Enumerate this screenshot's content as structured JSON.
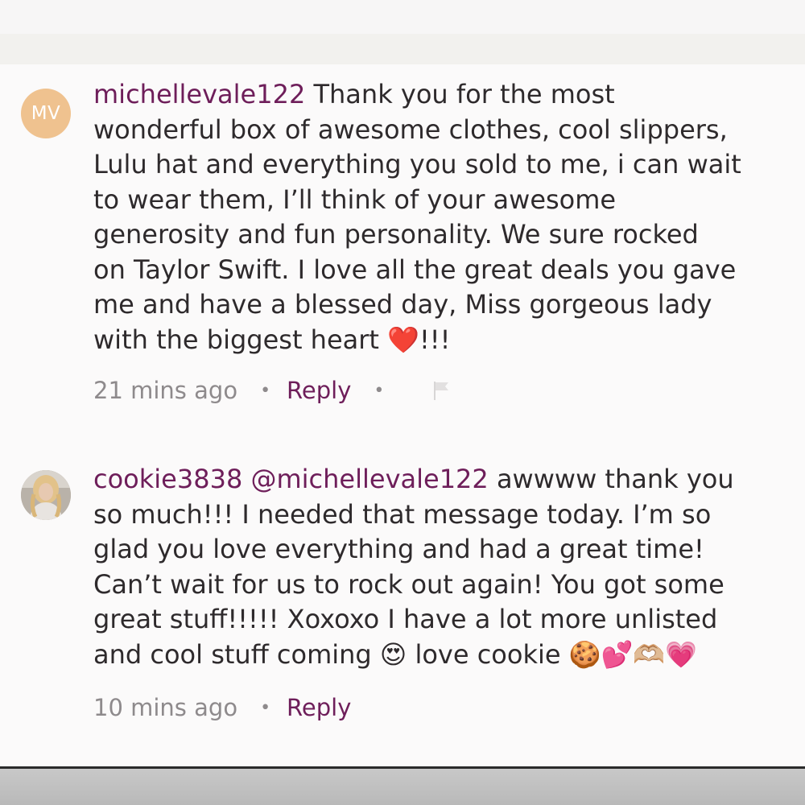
{
  "comments": [
    {
      "avatar_initials": "MV",
      "username": "michellevale122",
      "mention": "",
      "text": "Thank you for the most\nwonderful box of awesome clothes, cool slippers,\nLulu hat and everything you sold to me, i can wait\nto wear them, I’ll think of your awesome\ngenerosity and fun personality.  We sure rocked\non Taylor Swift.  I love all the great deals you gave\nme and have a blessed day, Miss gorgeous lady\nwith the biggest heart ❤️!!!",
      "time": "21 mins ago",
      "reply_label": "Reply",
      "has_flag": true
    },
    {
      "avatar_initials": "",
      "username": "cookie3838",
      "mention": "@michellevale122",
      "text": "awwww thank you\nso much!!! I needed that message today. I’m so\nglad you love everything and had a great time!\nCan’t wait for us to rock out again! You got some\ngreat stuff!!!!! Xoxoxo I have a lot more unlisted\nand cool stuff coming 😍 love cookie 🍪💕🫶🏼💗",
      "time": "10 mins ago",
      "reply_label": "Reply",
      "has_flag": false
    }
  ],
  "icons": {
    "separator": "•",
    "flag": "flag-icon"
  },
  "colors": {
    "username": "#6e1e5a",
    "reply": "#6e1e5a",
    "timestamp": "#8e8a8c",
    "avatar_mv": "#efc28f"
  }
}
